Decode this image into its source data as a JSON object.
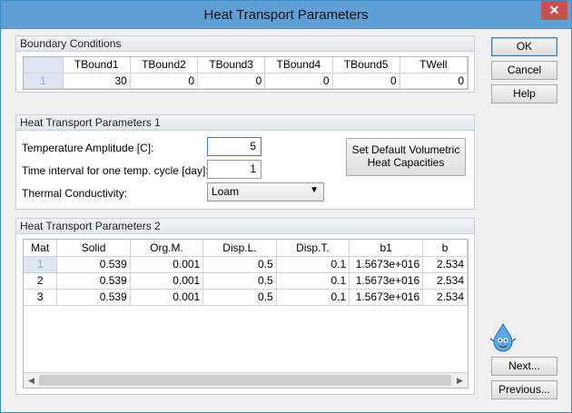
{
  "window": {
    "title": "Heat Transport Parameters",
    "close_glyph": "✕"
  },
  "buttons": {
    "ok": "OK",
    "cancel": "Cancel",
    "help": "Help",
    "next": "Next...",
    "previous": "Previous...",
    "set_default": "Set Default Volumetric Heat Capacities"
  },
  "boundary": {
    "title": "Boundary Conditions",
    "columns": [
      "",
      "TBound1",
      "TBound2",
      "TBound3",
      "TBound4",
      "TBound5",
      "TWell"
    ],
    "rows": [
      [
        "1",
        "30",
        "0",
        "0",
        "0",
        "0",
        "0"
      ]
    ]
  },
  "params1": {
    "title": "Heat Transport Parameters 1",
    "temp_amplitude_label": "Temperature Amplitude [C]:",
    "temp_amplitude_value": "5",
    "time_interval_label": "Time interval for one temp. cycle [day]:",
    "time_interval_value": "1",
    "thermal_conductivity_label": "Thermal Conductivity:",
    "thermal_conductivity_value": "Loam",
    "dropdown_arrow": "▼"
  },
  "params2": {
    "title": "Heat Transport Parameters 2",
    "columns": [
      "Mat",
      "Solid",
      "Org.M.",
      "Disp.L.",
      "Disp.T.",
      "b1",
      "b"
    ],
    "rows": [
      [
        "1",
        "0.539",
        "0.001",
        "0.5",
        "0.1",
        "1.5673e+016",
        "2.534"
      ],
      [
        "2",
        "0.539",
        "0.001",
        "0.5",
        "0.1",
        "1.5673e+016",
        "2.534"
      ],
      [
        "3",
        "0.539",
        "0.001",
        "0.5",
        "0.1",
        "1.5673e+016",
        "2.534"
      ]
    ],
    "scroll_left": "◀",
    "scroll_right": "▶"
  }
}
